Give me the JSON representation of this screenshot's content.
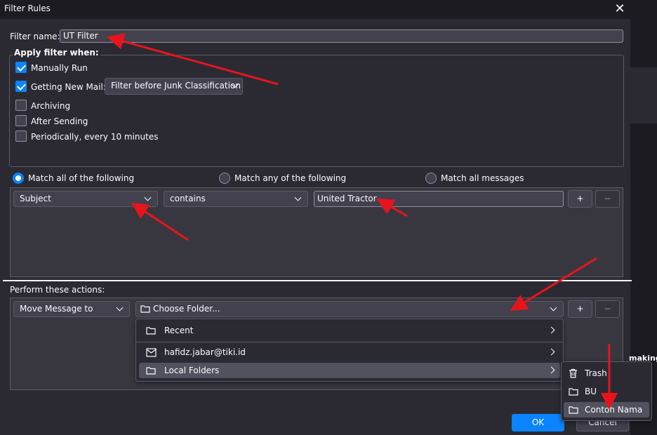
{
  "window": {
    "title": "Filter Rules",
    "close_glyph": "✕"
  },
  "background": {
    "partial_word": "making"
  },
  "filter_name": {
    "label": "Filter name:",
    "value": "UT Filter"
  },
  "apply_when": {
    "legend": "Apply filter when:",
    "items": [
      {
        "label": "Manually Run",
        "checked": true
      },
      {
        "label": "Getting New Mail:",
        "checked": true
      },
      {
        "label": "Archiving",
        "checked": false
      },
      {
        "label": "After Sending",
        "checked": false
      },
      {
        "label": "Periodically, every 10 minutes",
        "checked": false
      }
    ],
    "new_mail_option": "Filter before Junk Classification"
  },
  "match": {
    "options": [
      "Match all of the following",
      "Match any of the following",
      "Match all messages"
    ],
    "selected": "Match all of the following"
  },
  "rule": {
    "field": "Subject",
    "operator": "contains",
    "value": "United Tractor",
    "add": "+",
    "remove": "−"
  },
  "actions": {
    "label": "Perform these actions:",
    "action": "Move Message to",
    "target": "Choose Folder...",
    "add": "+",
    "remove": "−"
  },
  "folder_menu": {
    "items": [
      "Recent",
      "hafidz.jabar@tiki.id",
      "Local Folders"
    ]
  },
  "local_folders_menu": {
    "items": [
      "Trash",
      "BU",
      "Contoh Nama"
    ],
    "highlighted": "Contoh Nama"
  },
  "buttons": {
    "ok": "OK",
    "cancel": "Cancel"
  },
  "colors": {
    "accent": "#0a84ff",
    "annotation_arrow": "#e8141c",
    "background": "#2b2a33"
  }
}
